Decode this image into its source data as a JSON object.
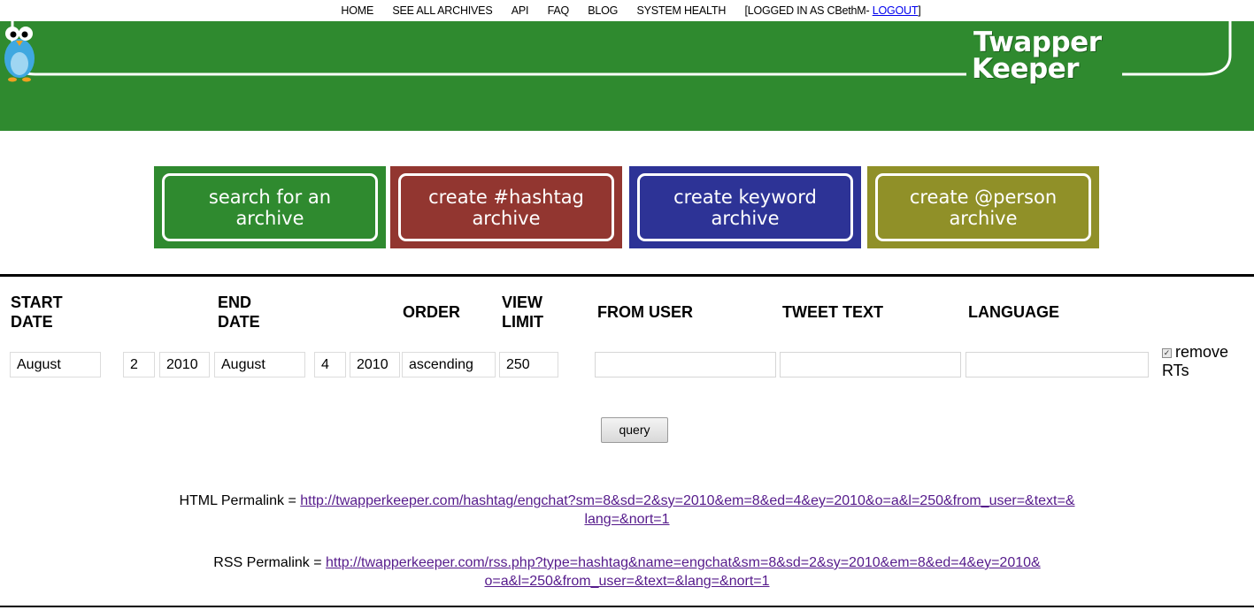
{
  "nav": {
    "items": [
      "HOME",
      "SEE ALL ARCHIVES",
      "API",
      "FAQ",
      "BLOG",
      "SYSTEM HEALTH"
    ],
    "logged_in_prefix": "[LOGGED IN AS CBethM-",
    "logout_label": "LOGOUT",
    "logged_in_suffix": "]"
  },
  "logo": {
    "line1": "Twapper",
    "line2": "Keeper",
    "icon": "bird-mascot-icon"
  },
  "actions": [
    {
      "label_line1": "search for an",
      "label_line2": "archive",
      "color": "#2f8a2f"
    },
    {
      "label_line1": "create #hashtag",
      "label_line2": "archive",
      "color": "#923630"
    },
    {
      "label_line1": "create keyword",
      "label_line2": "archive",
      "color": "#2d3396"
    },
    {
      "label_line1": "create @person",
      "label_line2": "archive",
      "color": "#909028"
    }
  ],
  "query": {
    "headers": {
      "start_date_1": "START",
      "start_date_2": "DATE",
      "end_date_1": "END",
      "end_date_2": "DATE",
      "order": "ORDER",
      "view_limit_1": "VIEW",
      "view_limit_2": "LIMIT",
      "from_user": "FROM USER",
      "tweet_text": "TWEET TEXT",
      "language": "LANGUAGE"
    },
    "start_month": "August",
    "start_day": "2",
    "start_year": "2010",
    "end_month": "August",
    "end_day": "4",
    "end_year": "2010",
    "order": "ascending",
    "view_limit": "250",
    "from_user": "",
    "tweet_text": "",
    "language": "",
    "remove_rts_label_1": "remove",
    "remove_rts_label_2": "RTs",
    "remove_rts_checked": true,
    "submit_label": "query"
  },
  "permalinks": {
    "html_label": "HTML Permalink = ",
    "html_url_1": "http://twapperkeeper.com/hashtag/engchat?sm=8&sd=2&sy=2010&em=8&ed=4&ey=2010&o=a&l=250&from_user=&text=&",
    "html_url_2": "lang=&nort=1",
    "rss_label": "RSS Permalink = ",
    "rss_url_1": "http://twapperkeeper.com/rss.php?type=hashtag&name=engchat&sm=8&sd=2&sy=2010&em=8&ed=4&ey=2010&",
    "rss_url_2": "o=a&l=250&from_user=&text=&lang=&nort=1"
  },
  "colors": {
    "banner_green": "#2f8a2f",
    "link_visited": "#551a8b",
    "link": "#0000ee"
  }
}
